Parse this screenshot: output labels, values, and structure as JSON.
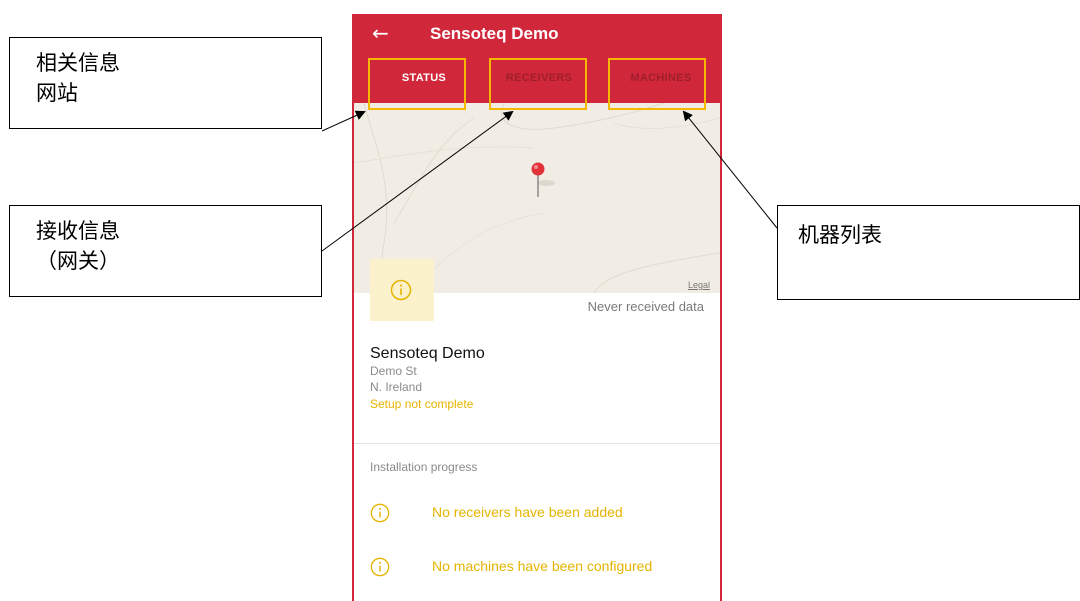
{
  "app": {
    "title": "Sensoteq Demo",
    "back_icon": "arrow-left-icon",
    "accent_color": "#d0283a",
    "warning_color": "#e6b400"
  },
  "tabs": [
    {
      "label": "STATUS",
      "active": true
    },
    {
      "label": "RECEIVERS",
      "active": false
    },
    {
      "label": "MACHINES",
      "active": false
    }
  ],
  "map": {
    "legal_label": "Legal",
    "pin_icon": "map-pin-icon"
  },
  "site": {
    "status_icon": "info-icon",
    "status_text": "Never received data",
    "name": "Sensoteq Demo",
    "address_line1": "Demo St",
    "address_line2": "N. Ireland",
    "setup_status": "Setup not complete"
  },
  "installation": {
    "title": "Installation progress",
    "items": [
      {
        "icon": "info-icon",
        "text": "No receivers have been added"
      },
      {
        "icon": "info-icon",
        "text": "No machines have been configured"
      }
    ]
  },
  "annotations": {
    "callout_status": {
      "line1": "相关信息",
      "line2": "网站"
    },
    "callout_receivers": {
      "line1": "接收信息",
      "line2": "（网关）"
    },
    "callout_machines": {
      "line1": "机器列表"
    }
  }
}
